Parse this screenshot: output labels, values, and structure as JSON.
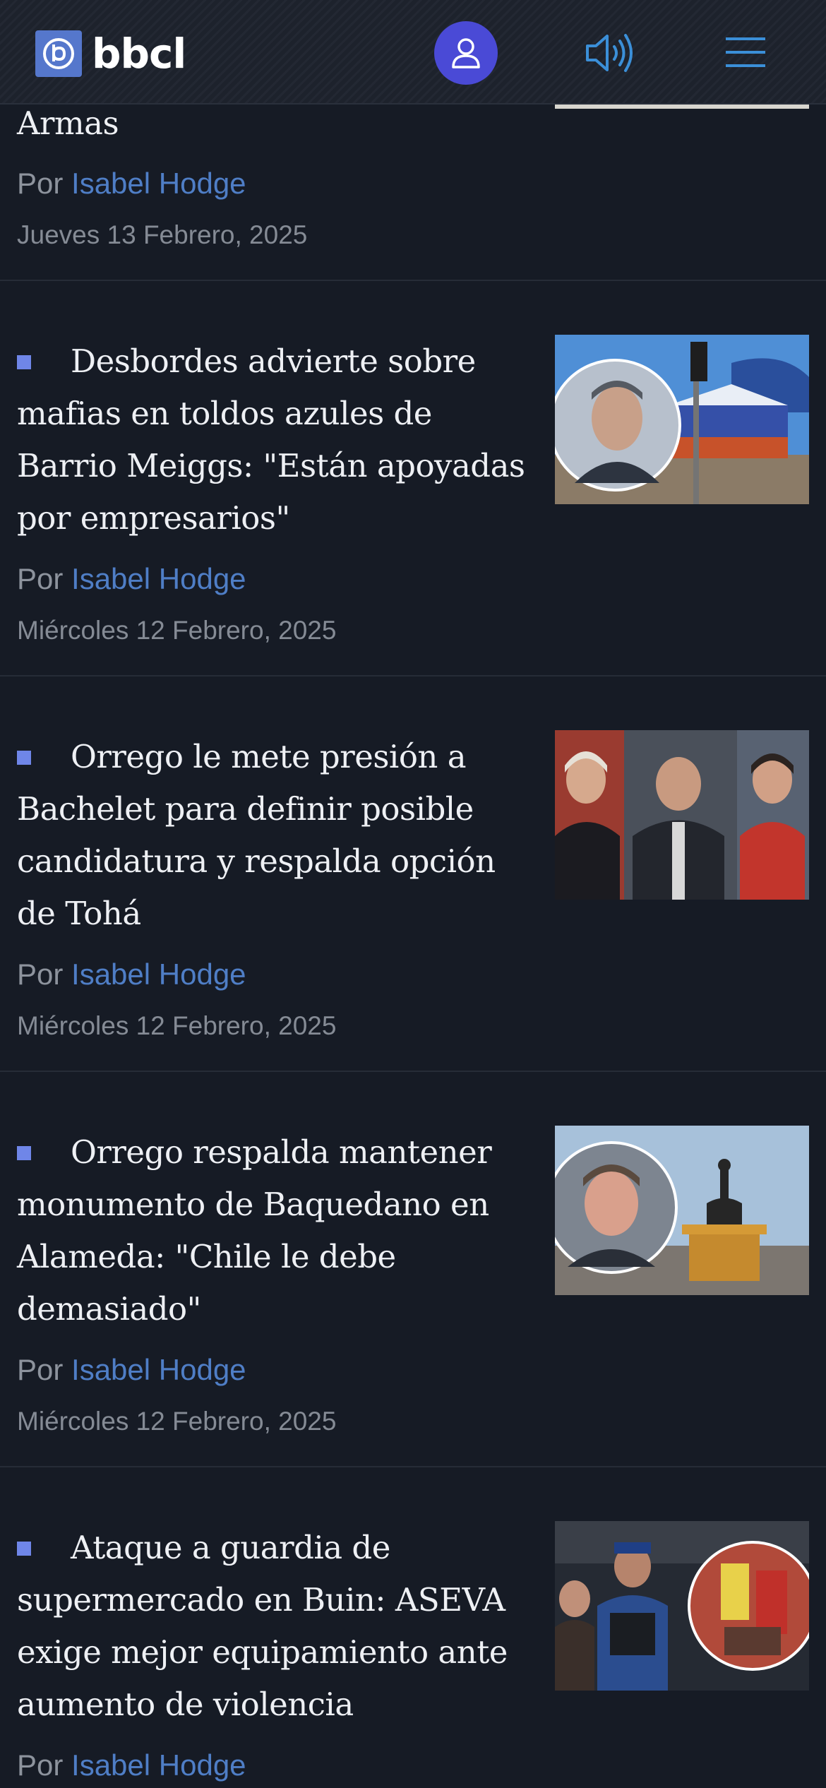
{
  "header": {
    "logo_text": "bbcl",
    "icons": [
      "bbcl-logo-icon",
      "user-icon",
      "speaker-icon",
      "hamburger-menu-icon"
    ],
    "accent_color": "#4a4ad6",
    "link_color": "#4f7ec6"
  },
  "articles": [
    {
      "title": "Armas",
      "by_prefix": "Por",
      "author": "Isabel Hodge",
      "date": "Jueves 13 Febrero, 2025"
    },
    {
      "title": "Desbordes advierte sobre mafias en toldos azules de Barrio Meiggs: \"Están apoyadas por empresarios\"",
      "by_prefix": "Por",
      "author": "Isabel Hodge",
      "date": "Miércoles 12 Febrero, 2025"
    },
    {
      "title": "Orrego le mete presión a Bachelet para definir posible candidatura y respalda opción de Tohá",
      "by_prefix": "Por",
      "author": "Isabel Hodge",
      "date": "Miércoles 12 Febrero, 2025"
    },
    {
      "title": "Orrego respalda mantener monumento de Baquedano en Alameda: \"Chile le debe demasiado\"",
      "by_prefix": "Por",
      "author": "Isabel Hodge",
      "date": "Miércoles 12 Febrero, 2025"
    },
    {
      "title": "Ataque a guardia de supermercado en Buin: ASEVA exige mejor equipamiento ante aumento de violencia",
      "by_prefix": "Por",
      "author": "Isabel Hodge"
    }
  ]
}
